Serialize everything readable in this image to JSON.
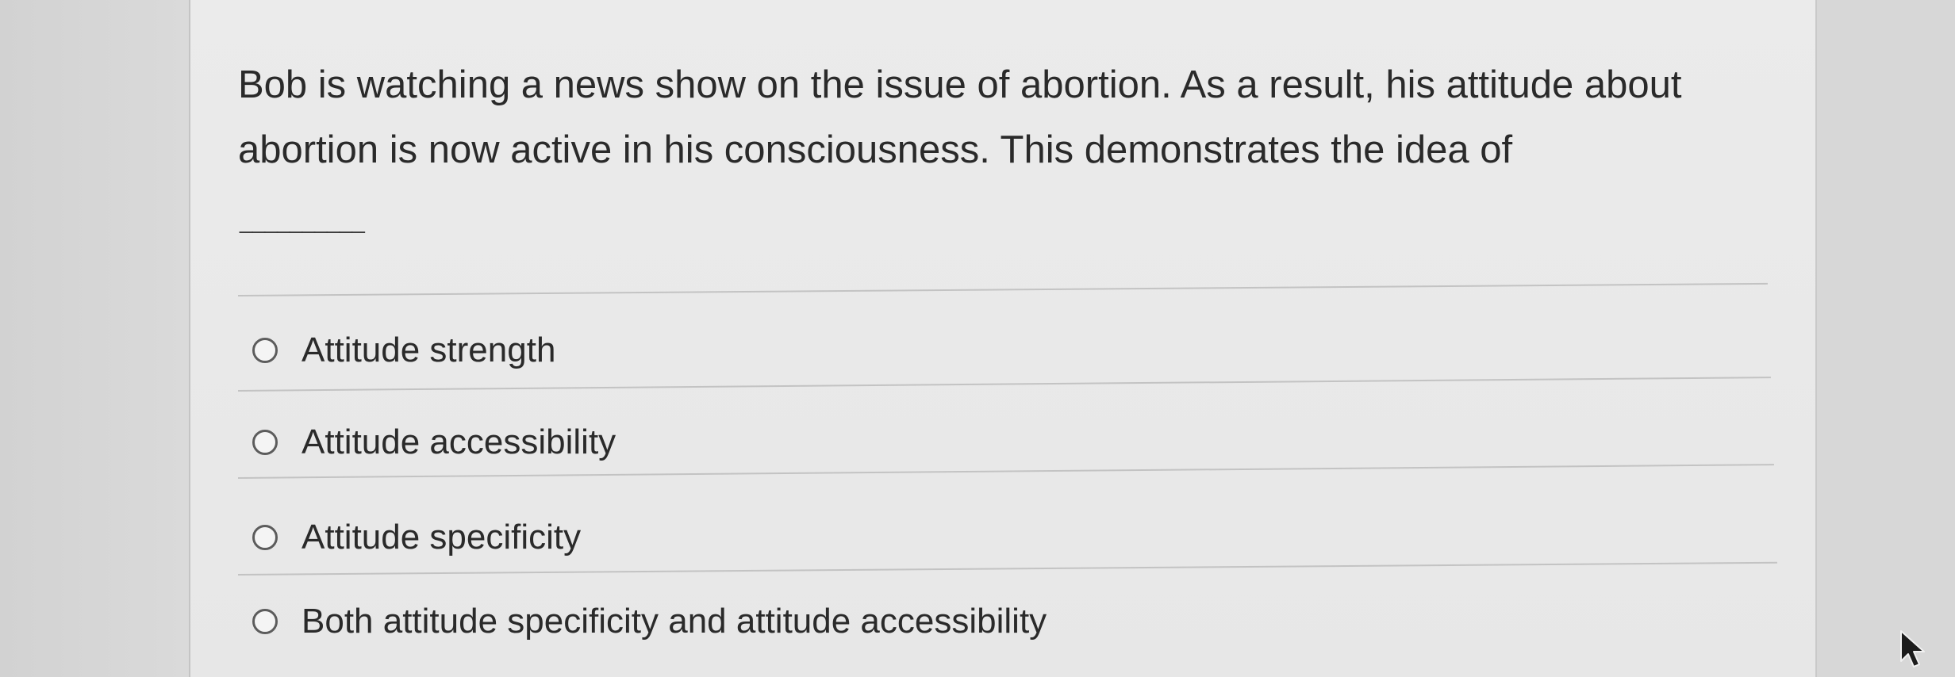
{
  "question": {
    "text": "Bob is watching a news show on the issue of abortion. As a result, his attitude about abortion is now active in his consciousness. This demonstrates the idea of",
    "blank": "__________"
  },
  "options": [
    {
      "label": "Attitude strength"
    },
    {
      "label": "Attitude accessibility"
    },
    {
      "label": "Attitude specificity"
    },
    {
      "label": "Both attitude specificity and attitude accessibility"
    }
  ]
}
